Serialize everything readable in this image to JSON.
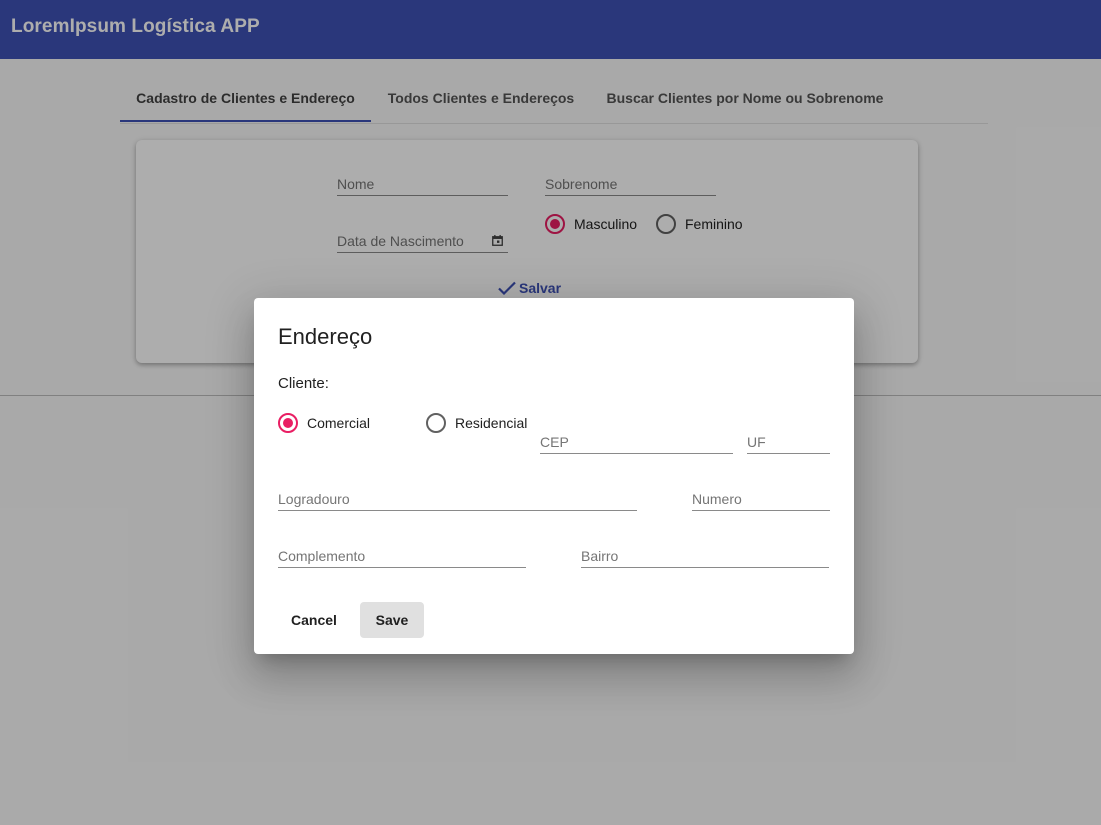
{
  "app": {
    "title": "LoremIpsum Logística APP"
  },
  "tabs": [
    {
      "label": "Cadastro de Clientes e Endereço",
      "active": true
    },
    {
      "label": "Todos Clientes e Endereços",
      "active": false
    },
    {
      "label": "Buscar Clientes por Nome ou Sobrenome",
      "active": false
    }
  ],
  "form": {
    "nome_placeholder": "Nome",
    "sobrenome_placeholder": "Sobrenome",
    "nascimento_placeholder": "Data de Nascimento",
    "gender_options": [
      {
        "label": "Masculino",
        "checked": true
      },
      {
        "label": "Feminino",
        "checked": false
      }
    ],
    "save_label": "Salvar"
  },
  "dialog": {
    "title": "Endereço",
    "cliente_label": "Cliente:",
    "type_options": [
      {
        "label": "Comercial",
        "checked": true
      },
      {
        "label": "Residencial",
        "checked": false
      }
    ],
    "cep_placeholder": "CEP",
    "uf_placeholder": "UF",
    "logradouro_placeholder": "Logradouro",
    "numero_placeholder": "Numero",
    "complemento_placeholder": "Complemento",
    "bairro_placeholder": "Bairro",
    "cancel_label": "Cancel",
    "save_label": "Save"
  },
  "colors": {
    "primary": "#3f51b5",
    "accent": "#e91e63"
  }
}
